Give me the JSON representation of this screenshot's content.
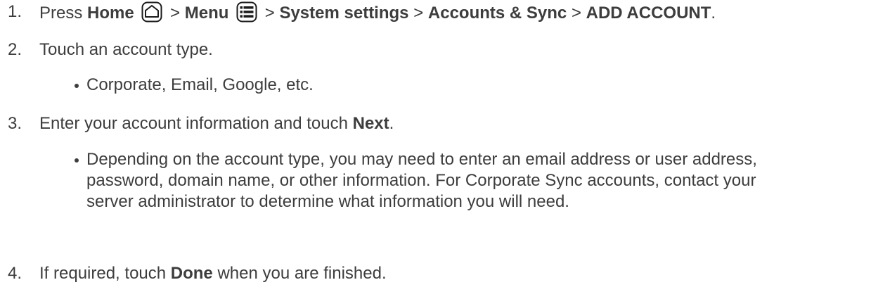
{
  "steps": [
    {
      "number": "1.",
      "parts": [
        "Press",
        "Home",
        ">",
        "Menu",
        ">",
        "System settings",
        ">",
        "Accounts & Sync",
        ">",
        "ADD ACCOUNT",
        "."
      ]
    },
    {
      "number": "2.",
      "text": "Touch an account type.",
      "bullet": "Corporate, Email, Google, etc."
    },
    {
      "number": "3.",
      "text_before": "Enter your account information and touch",
      "bold": "Next",
      "text_after": ".",
      "bullet_lines": [
        "Depending on the account type, you may need to enter an email address or user address,",
        "password, domain name, or other information. For Corporate Sync accounts, contact your",
        "server administrator to determine what information you will need."
      ]
    },
    {
      "number": "4.",
      "text_before": "If required, touch",
      "bold": "Done",
      "text_after": "when you are finished."
    }
  ],
  "icons": {
    "home": "home-key-icon",
    "menu": "menu-key-icon"
  }
}
